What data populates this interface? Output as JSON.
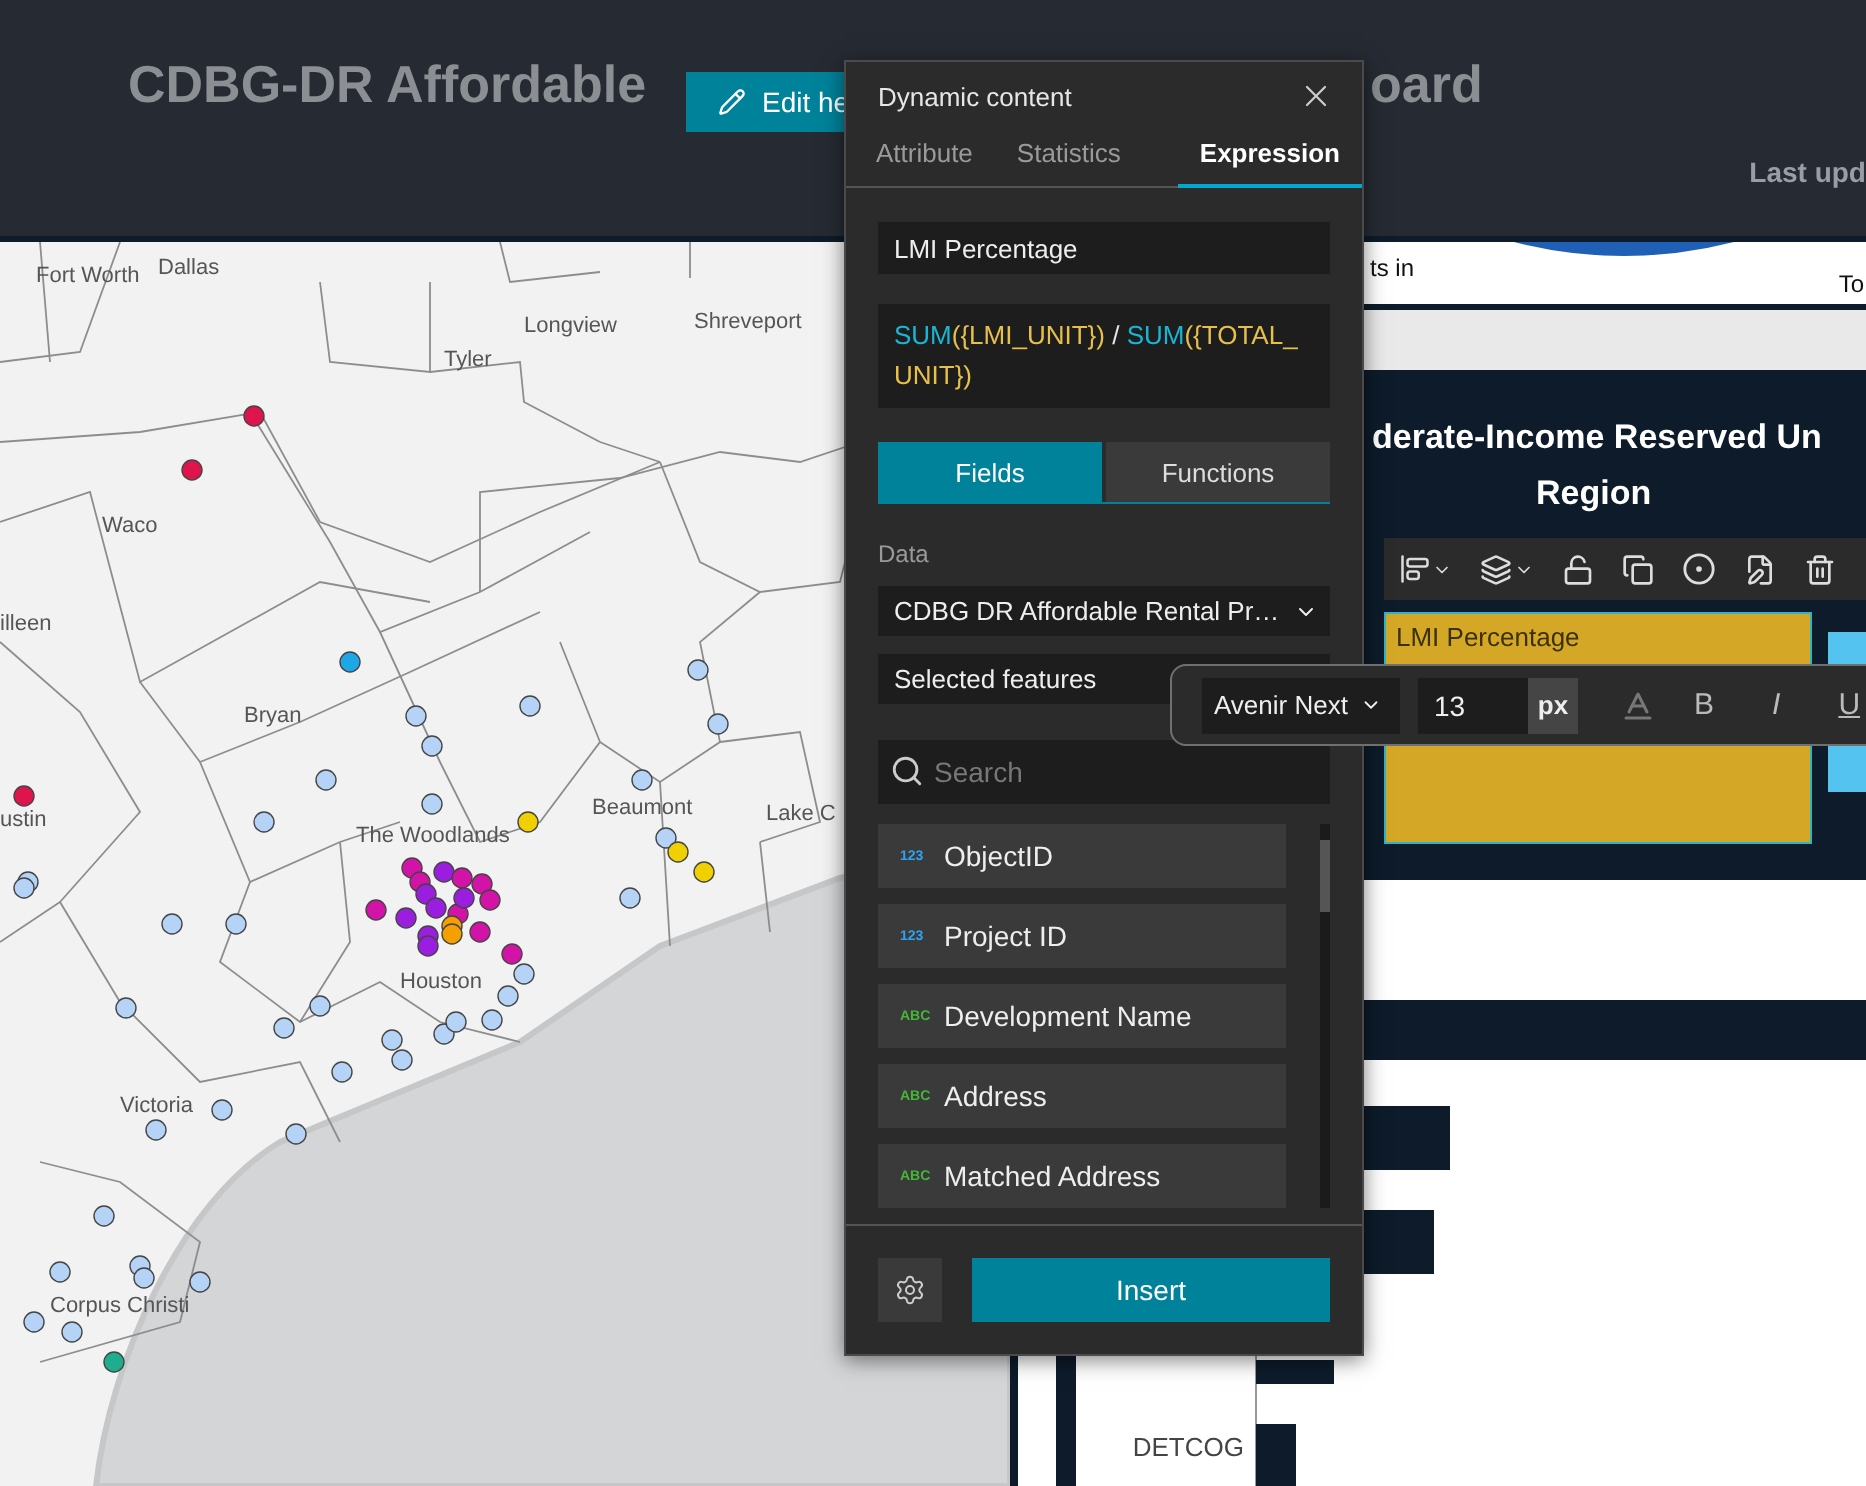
{
  "header": {
    "title_parts": [
      "CDBG-DR Affordable",
      "oard"
    ],
    "edit_button": "Edit he",
    "last_updated": "Last upd"
  },
  "map": {
    "labels": [
      "Fort Worth",
      "Dallas",
      "Longview",
      "Tyler",
      "Shreveport",
      "Waco",
      "illeen",
      "Bryan",
      "ustin",
      "The Woodlands",
      "Houston",
      "Beaumont",
      "Lake C",
      "Victoria",
      "Corpus Christi"
    ]
  },
  "dialog": {
    "title": "Dynamic content",
    "tabs": [
      {
        "label": "Attribute",
        "selected": false
      },
      {
        "label": "Statistics",
        "selected": false
      },
      {
        "label": "Expression",
        "selected": true
      }
    ],
    "name_value": "LMI Percentage",
    "expression": [
      {
        "text": "SUM",
        "kind": "function"
      },
      {
        "text": "({LMI_UNIT})",
        "kind": "field"
      },
      {
        "text": " / ",
        "kind": "operator"
      },
      {
        "text": "SUM",
        "kind": "function"
      },
      {
        "text": "({TOTAL_UNIT})",
        "kind": "field"
      }
    ],
    "modes": [
      {
        "label": "Fields",
        "selected": true
      },
      {
        "label": "Functions",
        "selected": false
      }
    ],
    "data_label": "Data",
    "source": "CDBG DR Affordable Rental Pr…",
    "filter": "Selected features",
    "search": {
      "placeholder": "Search"
    },
    "fields": [
      {
        "kind": "number",
        "badge": "123",
        "name": "ObjectID"
      },
      {
        "kind": "number",
        "badge": "123",
        "name": "Project ID"
      },
      {
        "kind": "string",
        "badge": "ABC",
        "name": "Development Name"
      },
      {
        "kind": "string",
        "badge": "ABC",
        "name": "Address"
      },
      {
        "kind": "string",
        "badge": "ABC",
        "name": "Matched Address"
      }
    ],
    "insert_button": "Insert"
  },
  "dashboard": {
    "card_left": "ts in",
    "card_right": "To",
    "panel_title": [
      "derate-Income Reserved Un",
      "Region"
    ],
    "text_box": "LMI Percentage",
    "chart_label": "DETCOG"
  },
  "text_toolbar": {
    "font": "Avenir Next",
    "size": "13",
    "unit": "px",
    "bold": "B",
    "italic": "I",
    "underline": "U"
  }
}
